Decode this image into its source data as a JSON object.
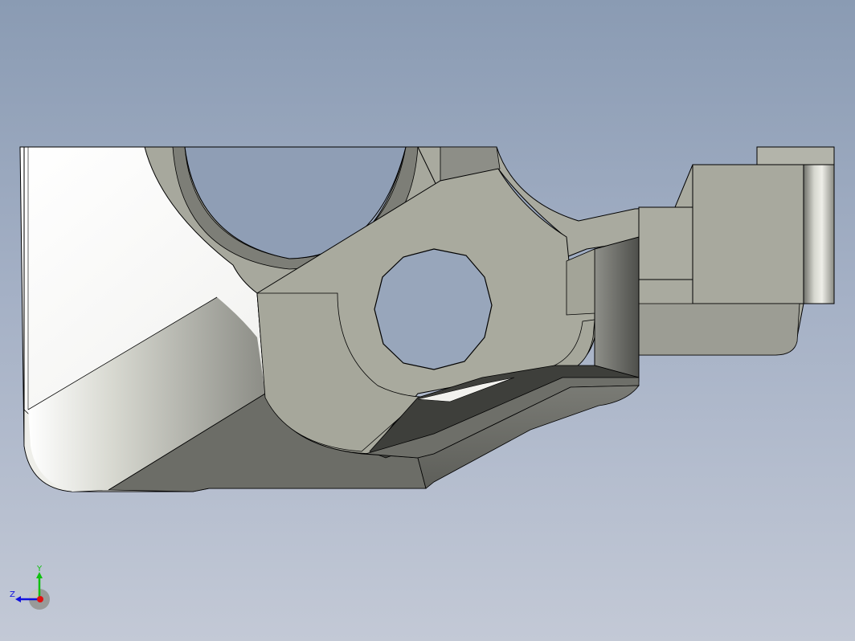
{
  "viewport": {
    "background_top": "#8a9bb3",
    "background_bottom": "#c3c9d6"
  },
  "model": {
    "face_color": "#a9aa9f",
    "shadow_color": "#6a6b65",
    "highlight_color": "#ffffff",
    "edge_color": "#000000"
  },
  "triad": {
    "x_label": "",
    "y_label": "Y",
    "z_label": "Z",
    "x_color": "#e01010",
    "y_color": "#10c010",
    "z_color": "#1010e0"
  }
}
